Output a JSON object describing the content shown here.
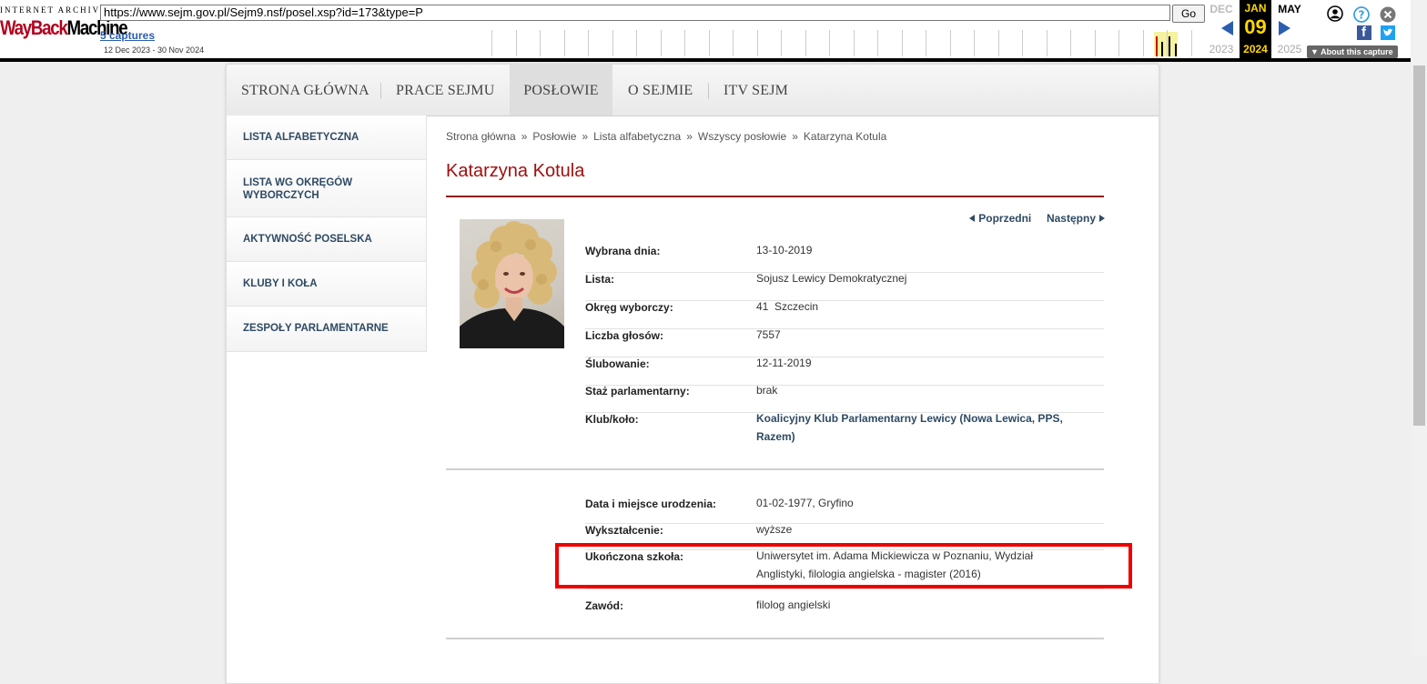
{
  "wayback": {
    "logo_top": "INTERNET ARCHIVE",
    "logo_main_red": "WayBack",
    "logo_main_black": "Machine",
    "url": "https://www.sejm.gov.pl/Sejm9.nsf/posel.xsp?id=173&type=P",
    "go_label": "Go",
    "captures": "5 captures",
    "date_range": "12 Dec 2023 - 30 Nov 2024",
    "prev_month": "DEC",
    "cur_month": "JAN",
    "next_month": "MAY",
    "cur_day": "09",
    "prev_year": "2023",
    "cur_year": "2024",
    "next_year": "2025",
    "about": "About this capture",
    "colors": {
      "accent": "#2a5db0",
      "current": "#ffd700"
    }
  },
  "nav": {
    "items": [
      {
        "label": "STRONA GŁÓWNA"
      },
      {
        "label": "PRACE SEJMU"
      },
      {
        "label": "POSŁOWIE"
      },
      {
        "label": "O SEJMIE"
      },
      {
        "label": "ITV SEJM"
      }
    ],
    "active": "POSŁOWIE"
  },
  "sidebar": {
    "items": [
      {
        "label": "LISTA ALFABETYCZNA"
      },
      {
        "label": "LISTA WG OKRĘGÓW",
        "label2": "WYBORCZYCH"
      },
      {
        "label": "AKTYWNOŚĆ POSELSKA"
      },
      {
        "label": "KLUBY I KOŁA"
      },
      {
        "label": "ZESPOŁY PARLAMENTARNE"
      }
    ]
  },
  "breadcrumb": {
    "items": [
      "Strona główna",
      "Posłowie",
      "Lista alfabetyczna",
      "Wszyscy posłowie",
      "Katarzyna Kotula"
    ],
    "sep": "»"
  },
  "profile": {
    "name": "Katarzyna Kotula",
    "prev": "Poprzedni",
    "next": "Następny",
    "info": [
      {
        "k": "Wybrana dnia:",
        "v": "13-10-2019"
      },
      {
        "k": "Lista:",
        "v": "Sojusz Lewicy Demokratycznej"
      },
      {
        "k": "Okręg wyborczy:",
        "v": "41  Szczecin"
      },
      {
        "k": "Liczba głosów:",
        "v": "7557"
      },
      {
        "k": "Ślubowanie:",
        "v": "12-11-2019"
      },
      {
        "k": "Staż parlamentarny:",
        "v": "brak"
      },
      {
        "k": "Klub/koło:",
        "v": "Koalicyjny Klub Parlamentarny Lewicy (Nowa Lewica, PPS, Razem)"
      }
    ],
    "bio": [
      {
        "k": "Data i miejsce urodzenia:",
        "v": "01-02-1977, Gryfino"
      },
      {
        "k": "Wykształcenie:",
        "v": "wyższe"
      },
      {
        "k": "Ukończona szkoła:",
        "v": "Uniwersytet im. Adama Mickiewicza w Poznaniu, Wydział Anglistyki, filologia angielska - magister (2016)"
      },
      {
        "k": "Zawód:",
        "v": "filolog angielski"
      }
    ],
    "colors": {
      "title": "#a01010",
      "link": "#2e4a63",
      "highlight": "#ee0000"
    }
  }
}
